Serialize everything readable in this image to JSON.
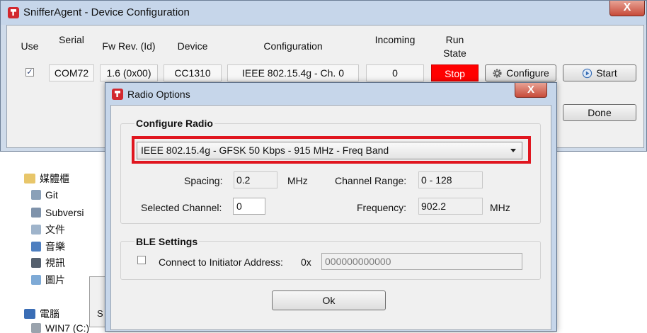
{
  "main_window": {
    "title": "SnifferAgent - Device Configuration",
    "close_label": "X",
    "headers": {
      "use": "Use",
      "serial": "Serial",
      "fw_rev": "Fw Rev. (Id)",
      "device": "Device",
      "configuration": "Configuration",
      "incoming": "Incoming",
      "run_state_1": "Run",
      "run_state_2": "State"
    },
    "row": {
      "use_checked": "✓",
      "serial": "COM72",
      "fw_rev": "1.6 (0x00)",
      "device": "CC1310",
      "configuration": "IEEE 802.15.4g - Ch. 0",
      "incoming": "0",
      "run_state": "Stop"
    },
    "buttons": {
      "configure": "Configure",
      "start": "Start",
      "done": "Done"
    }
  },
  "explorer": {
    "items": [
      "媒體櫃",
      "Git",
      "Subversi",
      "文件",
      "音樂",
      "視訊",
      "圖片",
      "電腦",
      "WIN7 (C:)"
    ],
    "panel_fragment": "S"
  },
  "dialog": {
    "title": "Radio Options",
    "close_label": "X",
    "configure_radio": {
      "title": "Configure Radio",
      "selected_option": "IEEE 802.15.4g - GFSK 50 Kbps - 915 MHz - Freq Band",
      "spacing_label": "Spacing:",
      "spacing_value": "0.2",
      "spacing_unit": "MHz",
      "channel_range_label": "Channel Range:",
      "channel_range_value": "0 - 128",
      "selected_channel_label": "Selected Channel:",
      "selected_channel_value": "0",
      "frequency_label": "Frequency:",
      "frequency_value": "902.2",
      "frequency_unit": "MHz"
    },
    "ble_settings": {
      "title": "BLE Settings",
      "connect_label": "Connect to Initiator Address:",
      "prefix": "0x",
      "address_placeholder": "000000000000"
    },
    "ok_label": "Ok"
  },
  "colors": {
    "stop_bg": "#ff0000",
    "highlight": "#e0161f",
    "titlebar": "#c6d6ea"
  }
}
